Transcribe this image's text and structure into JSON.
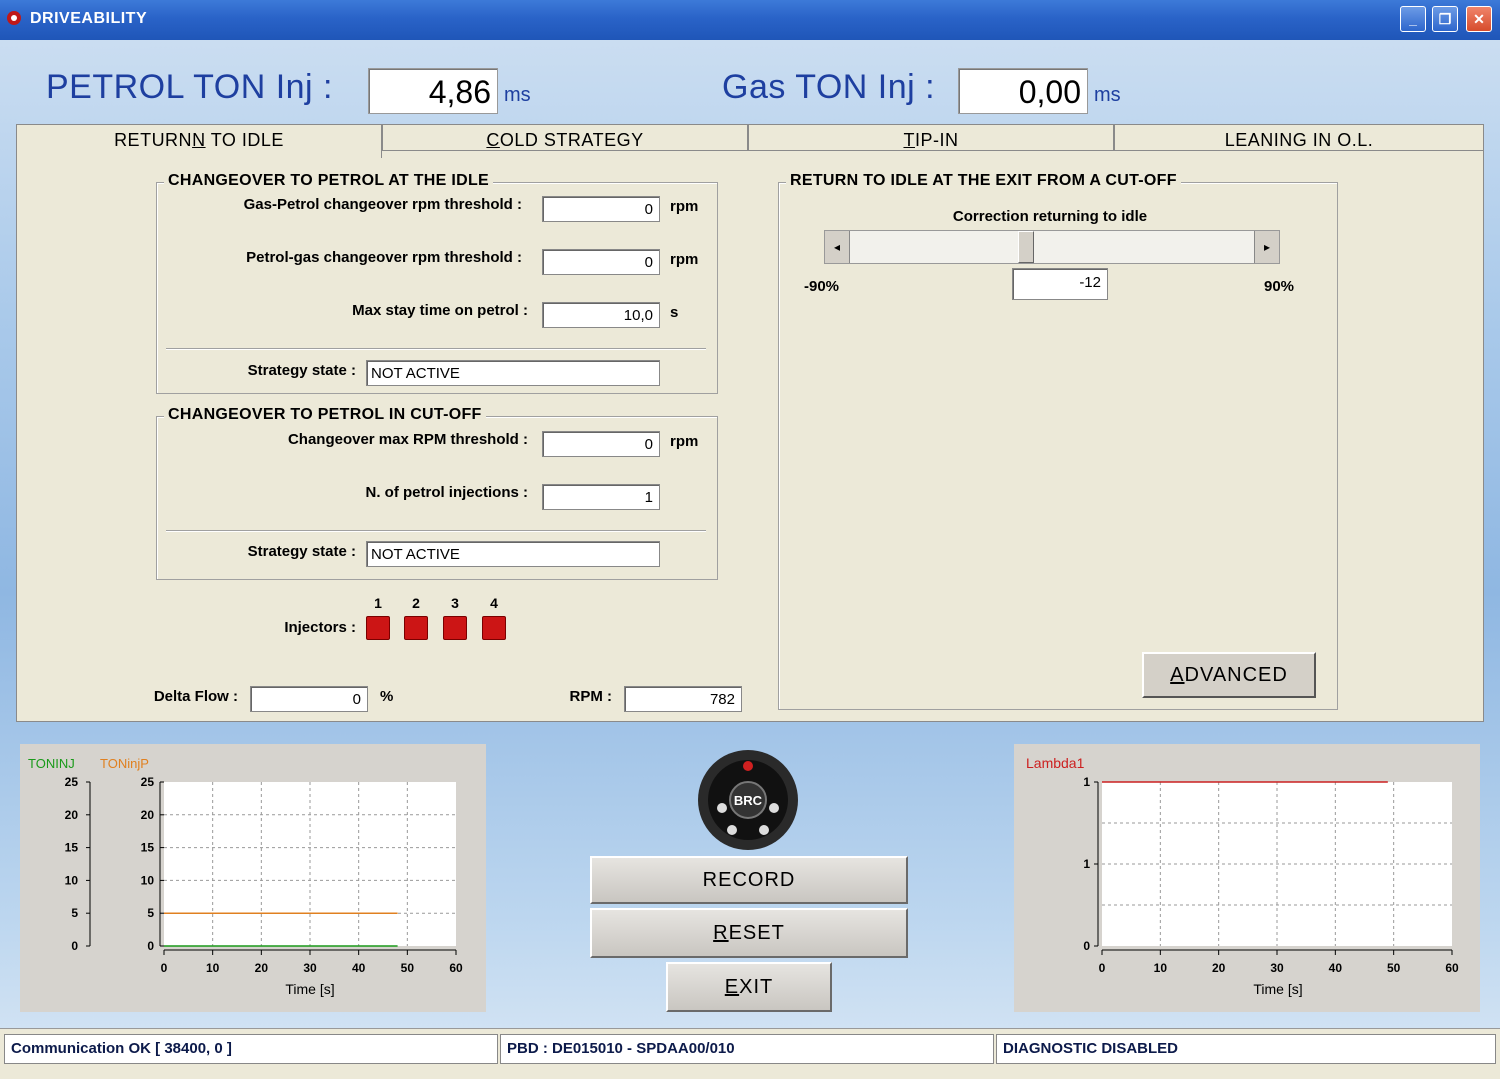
{
  "window": {
    "title": "DRIVEABILITY"
  },
  "header": {
    "petrol_label": "PETROL TON Inj :",
    "petrol_value": "4,86",
    "petrol_unit": "ms",
    "gas_label": "Gas TON Inj :",
    "gas_value": "0,00",
    "gas_unit": "ms"
  },
  "tabs": [
    {
      "label_pre": "RETURN",
      "label_ul": "N",
      "label_post": " TO IDLE",
      "active": true
    },
    {
      "label_pre": "",
      "label_ul": "C",
      "label_post": "OLD STRATEGY"
    },
    {
      "label_pre": "",
      "label_ul": "T",
      "label_post": "IP-IN"
    },
    {
      "label_pre": "LEANING IN O.L.",
      "label_ul": "",
      "label_post": ""
    }
  ],
  "idle_group": {
    "title": "CHANGEOVER TO PETROL AT THE IDLE",
    "gas_petrol_label": "Gas-Petrol changeover rpm threshold :",
    "gas_petrol_value": "0",
    "petrol_gas_label": "Petrol-gas changeover rpm threshold :",
    "petrol_gas_value": "0",
    "max_stay_label": "Max stay time on petrol :",
    "max_stay_value": "10,0",
    "max_stay_unit": "s",
    "rpm_unit": "rpm",
    "state_label": "Strategy state :",
    "state_value": "NOT ACTIVE"
  },
  "cutoff_group": {
    "title": "CHANGEOVER TO PETROL IN CUT-OFF",
    "rpm_label": "Changeover max RPM threshold :",
    "rpm_value": "0",
    "rpm_unit": "rpm",
    "inj_label": "N. of petrol injections :",
    "inj_value": "1",
    "state_label": "Strategy state :",
    "state_value": "NOT ACTIVE"
  },
  "injectors": {
    "label": "Injectors :",
    "numbers": [
      "1",
      "2",
      "3",
      "4"
    ],
    "color": "#cc1515"
  },
  "delta_flow": {
    "label": "Delta Flow :",
    "value": "0",
    "unit": "%"
  },
  "rpm": {
    "label": "RPM :",
    "value": "782"
  },
  "cutoff_idle": {
    "title": "RETURN TO IDLE AT THE EXIT FROM A CUT-OFF",
    "slider_label": "Correction returning to idle",
    "min_label": "-90%",
    "max_label": "90%",
    "value": "-12",
    "value_num": -12,
    "min": -90,
    "max": 90
  },
  "advanced_button": {
    "label_ul": "A",
    "label_post": "DVANCED"
  },
  "chart_left": {
    "legend_a": "TONINJ",
    "legend_a_color": "#1a9a1a",
    "legend_b": "TONinjP",
    "legend_b_color": "#e08020",
    "yticks_outer": [
      "25",
      "20",
      "15",
      "10",
      "5",
      "0"
    ],
    "yticks_inner": [
      "25",
      "20",
      "15",
      "10",
      "5",
      "0"
    ],
    "xticks": [
      "0",
      "10",
      "20",
      "30",
      "40",
      "50",
      "60"
    ],
    "xlabel": "Time [s]"
  },
  "chart_right": {
    "legend": "Lambda1",
    "legend_color": "#cc2020",
    "yticks": [
      "1",
      "1",
      "0"
    ],
    "xticks": [
      "0",
      "10",
      "20",
      "30",
      "40",
      "50",
      "60"
    ],
    "xlabel": "Time [s]"
  },
  "buttons": {
    "record": "RECORD",
    "reset_ul": "R",
    "reset_post": "ESET",
    "exit_ul": "E",
    "exit_post": "XIT"
  },
  "logo": {
    "text": "BRC"
  },
  "status": {
    "communication": "Communication OK [ 38400, 0 ]",
    "pbd": "PBD : DE015010 - SPDAA00/010",
    "diagnostic": "DIAGNOSTIC DISABLED"
  },
  "chart_data": [
    {
      "type": "line",
      "title": "",
      "series": [
        {
          "name": "TONINJ",
          "x": [
            0,
            48
          ],
          "y": [
            0,
            0
          ]
        },
        {
          "name": "TONinjP",
          "x": [
            0,
            48
          ],
          "y": [
            5,
            5
          ]
        }
      ],
      "xlabel": "Time [s]",
      "ylabel": "",
      "xlim": [
        0,
        60
      ],
      "ylim": [
        0,
        25
      ],
      "grid": true
    },
    {
      "type": "line",
      "title": "",
      "series": [
        {
          "name": "Lambda1",
          "x": [
            0,
            49
          ],
          "y": [
            1,
            1
          ]
        }
      ],
      "xlabel": "Time [s]",
      "ylabel": "",
      "xlim": [
        0,
        60
      ],
      "ylim": [
        0,
        1
      ],
      "grid": true
    }
  ]
}
